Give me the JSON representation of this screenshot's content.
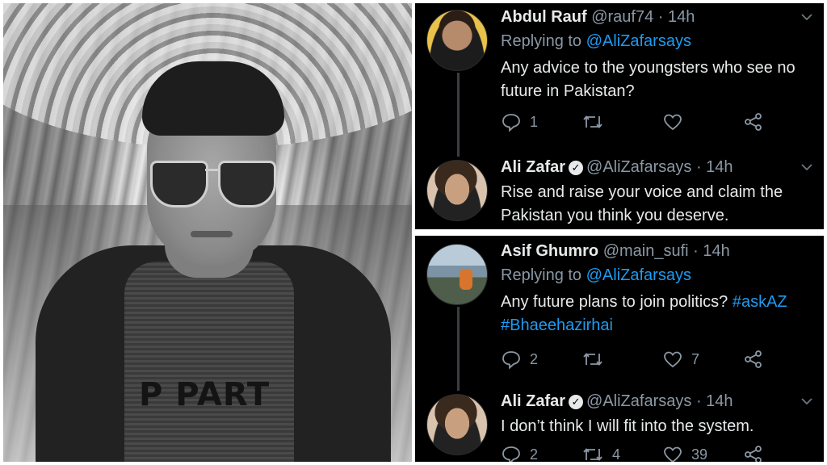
{
  "photo": {
    "shirt_text": "P PART"
  },
  "tweets_block_1": [
    {
      "name": "Abdul Rauf",
      "handle": "@rauf74",
      "time": "14h",
      "replying_label": "Replying to",
      "replying_to": "@AliZafarsays",
      "text": "Any advice to the youngsters who see no future in Pakistan?",
      "reply_count": "1",
      "retweet_count": "",
      "like_count": ""
    },
    {
      "name": "Ali Zafar",
      "handle": "@AliZafarsays",
      "time": "14h",
      "text": "Rise and raise your voice and claim the Pakistan you think you deserve."
    }
  ],
  "tweets_block_2": [
    {
      "name": "Asif Ghumro",
      "handle": "@main_sufi",
      "time": "14h",
      "replying_label": "Replying to",
      "replying_to": "@AliZafarsays",
      "text": "Any future plans to join politics?",
      "hashtag_1": "#askAZ",
      "hashtag_2": "#Bhaeehazirhai",
      "reply_count": "2",
      "retweet_count": "",
      "like_count": "7"
    },
    {
      "name": "Ali Zafar",
      "handle": "@AliZafarsays",
      "time": "14h",
      "text": "I don’t think I will fit into the system.",
      "reply_count": "2",
      "retweet_count": "4",
      "like_count": "39"
    }
  ],
  "separator": "·",
  "verified_mark": "✓",
  "icons": [
    "reply-icon",
    "retweet-icon",
    "like-icon",
    "share-icon",
    "chevron-down-icon",
    "verified-badge-icon"
  ],
  "colors": {
    "background": "#000000",
    "text": "#e7e9ea",
    "muted": "#8b98a5",
    "link": "#1d9bf0",
    "thread_line": "#3a3d41"
  }
}
